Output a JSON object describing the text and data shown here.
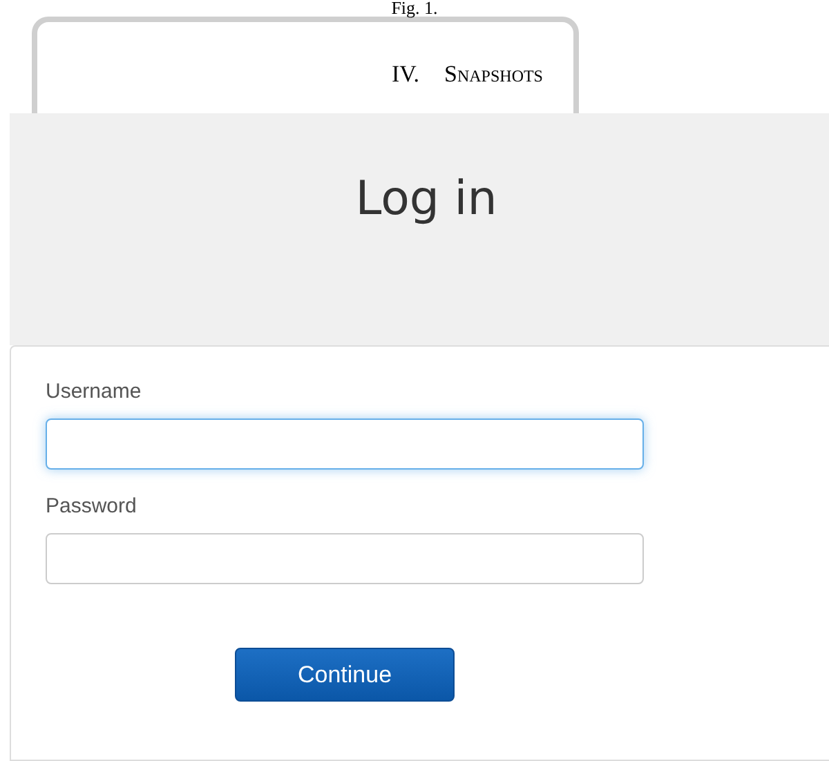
{
  "caption": "Fig. 1.",
  "section_heading": {
    "number": "IV.",
    "title": "Snapshots"
  },
  "screenshot": {
    "title": "Log in",
    "fields": [
      {
        "label": "Username",
        "focused": true
      },
      {
        "label": "Password",
        "focused": false
      }
    ],
    "button": "Continue"
  }
}
